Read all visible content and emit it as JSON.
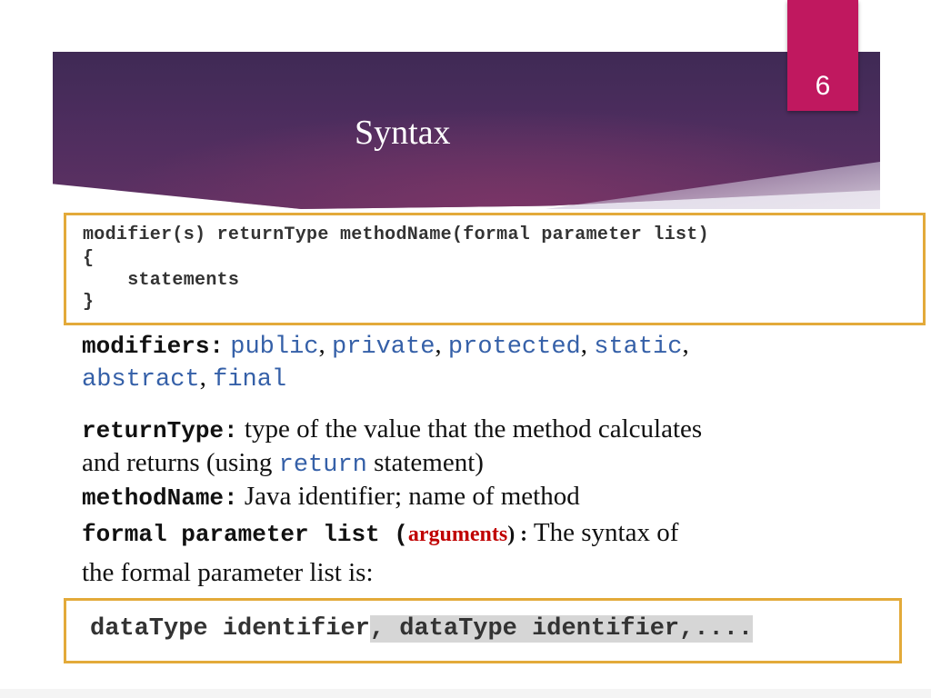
{
  "slide": {
    "title": "Syntax",
    "page_number": "6"
  },
  "syntax_box": {
    "lines": [
      "modifier(s) returnType methodName(formal parameter list)",
      "{",
      "    statements",
      "}"
    ]
  },
  "modifiers": {
    "label": "modifiers:",
    "values": [
      "public",
      "private",
      "protected",
      "static",
      "abstract",
      "final"
    ],
    "separator": ","
  },
  "return_type": {
    "label": "returnType:",
    "text_1": " type of the value that the method calculates",
    "text_2": "and returns (using ",
    "keyword": "return",
    "text_3": " statement)"
  },
  "method_name": {
    "label": "methodName:",
    "text": " Java identifier; name of method"
  },
  "formal_params": {
    "label": "formal parameter list (",
    "arguments": "arguments",
    "close": ") :",
    "text_1": " The syntax of",
    "text_2": "the formal parameter list is:"
  },
  "param_box": {
    "part_1": "dataType identifier",
    "part_2": ", dataType identifier,...."
  },
  "colors": {
    "banner": "#4d2d5e",
    "tab": "#c0185f",
    "box_border": "#e3aa3a",
    "code_blue": "#3560a8",
    "arguments_red": "#c00000"
  }
}
